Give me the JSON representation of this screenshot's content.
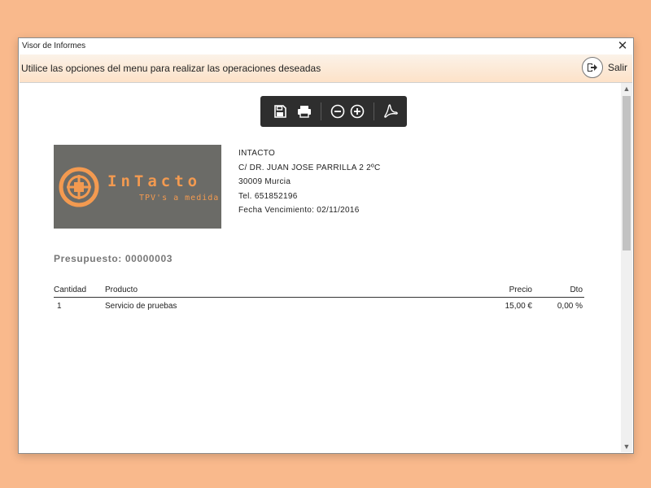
{
  "window": {
    "title": "Visor de Informes"
  },
  "infobar": {
    "message": "Utilice las opciones del menu para realizar las operaciones deseadas",
    "exit_label": "Salir"
  },
  "logo": {
    "brand": "InTacto",
    "tagline": "TPV's a medida"
  },
  "client": {
    "name": "INTACTO",
    "address": "C/ DR. JUAN JOSE PARRILLA 2 2ºC",
    "city": "30009 Murcia",
    "phone": "Tel. 651852196",
    "due_date": "Fecha Vencimiento: 02/11/2016"
  },
  "budget": {
    "label": "Presupuesto: 00000003"
  },
  "table": {
    "headers": {
      "quantity": "Cantidad",
      "product": "Producto",
      "price": "Precio",
      "discount": "Dto"
    },
    "rows": [
      {
        "quantity": "1",
        "product": "Servicio de pruebas",
        "price": "15,00 €",
        "discount": "0,00 %"
      }
    ]
  },
  "toolbar": {
    "icons": [
      "save-icon",
      "print-icon",
      "zoom-out-icon",
      "zoom-in-icon",
      "pdf-icon"
    ]
  },
  "colors": {
    "background": "#f9b98c",
    "logo_bg": "#6b6b67",
    "logo_accent": "#f39a50",
    "toolbar_bg": "#2e2e2e"
  }
}
